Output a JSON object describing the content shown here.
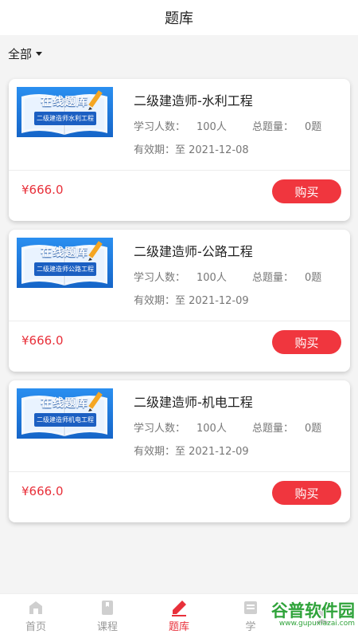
{
  "header": {
    "title": "题库"
  },
  "filter": {
    "label": "全部"
  },
  "stats_labels": {
    "learners_prefix": "学习人数：",
    "questions_prefix": "总题量：",
    "validity_prefix": "有效期：至 "
  },
  "buy_label": "购买",
  "thumb_title": "在线题库",
  "cards": [
    {
      "title": "二级建造师-水利工程",
      "thumb_sub": "二级建造师水利工程",
      "learners": "100人",
      "questions": "0题",
      "validity": "2021-12-08",
      "price": "¥666.0"
    },
    {
      "title": "二级建造师-公路工程",
      "thumb_sub": "二级建造师公路工程",
      "learners": "100人",
      "questions": "0题",
      "validity": "2021-12-09",
      "price": "¥666.0"
    },
    {
      "title": "二级建造师-机电工程",
      "thumb_sub": "二级建造师机电工程",
      "learners": "100人",
      "questions": "0题",
      "validity": "2021-12-09",
      "price": "¥666.0"
    }
  ],
  "tabs": [
    {
      "label": "首页",
      "icon": "home-icon",
      "active": false
    },
    {
      "label": "课程",
      "icon": "bookmark-icon",
      "active": false
    },
    {
      "label": "题库",
      "icon": "pencil-icon",
      "active": true
    },
    {
      "label": "学",
      "icon": "study-icon",
      "active": false
    },
    {
      "label": "",
      "icon": "profile-icon",
      "active": false
    }
  ],
  "watermark": {
    "main": "谷普软件园",
    "url": "www.gupuxiazai.com"
  },
  "colors": {
    "accent": "#f0363e",
    "price": "#e8303a",
    "watermark": "#2fa33a"
  }
}
